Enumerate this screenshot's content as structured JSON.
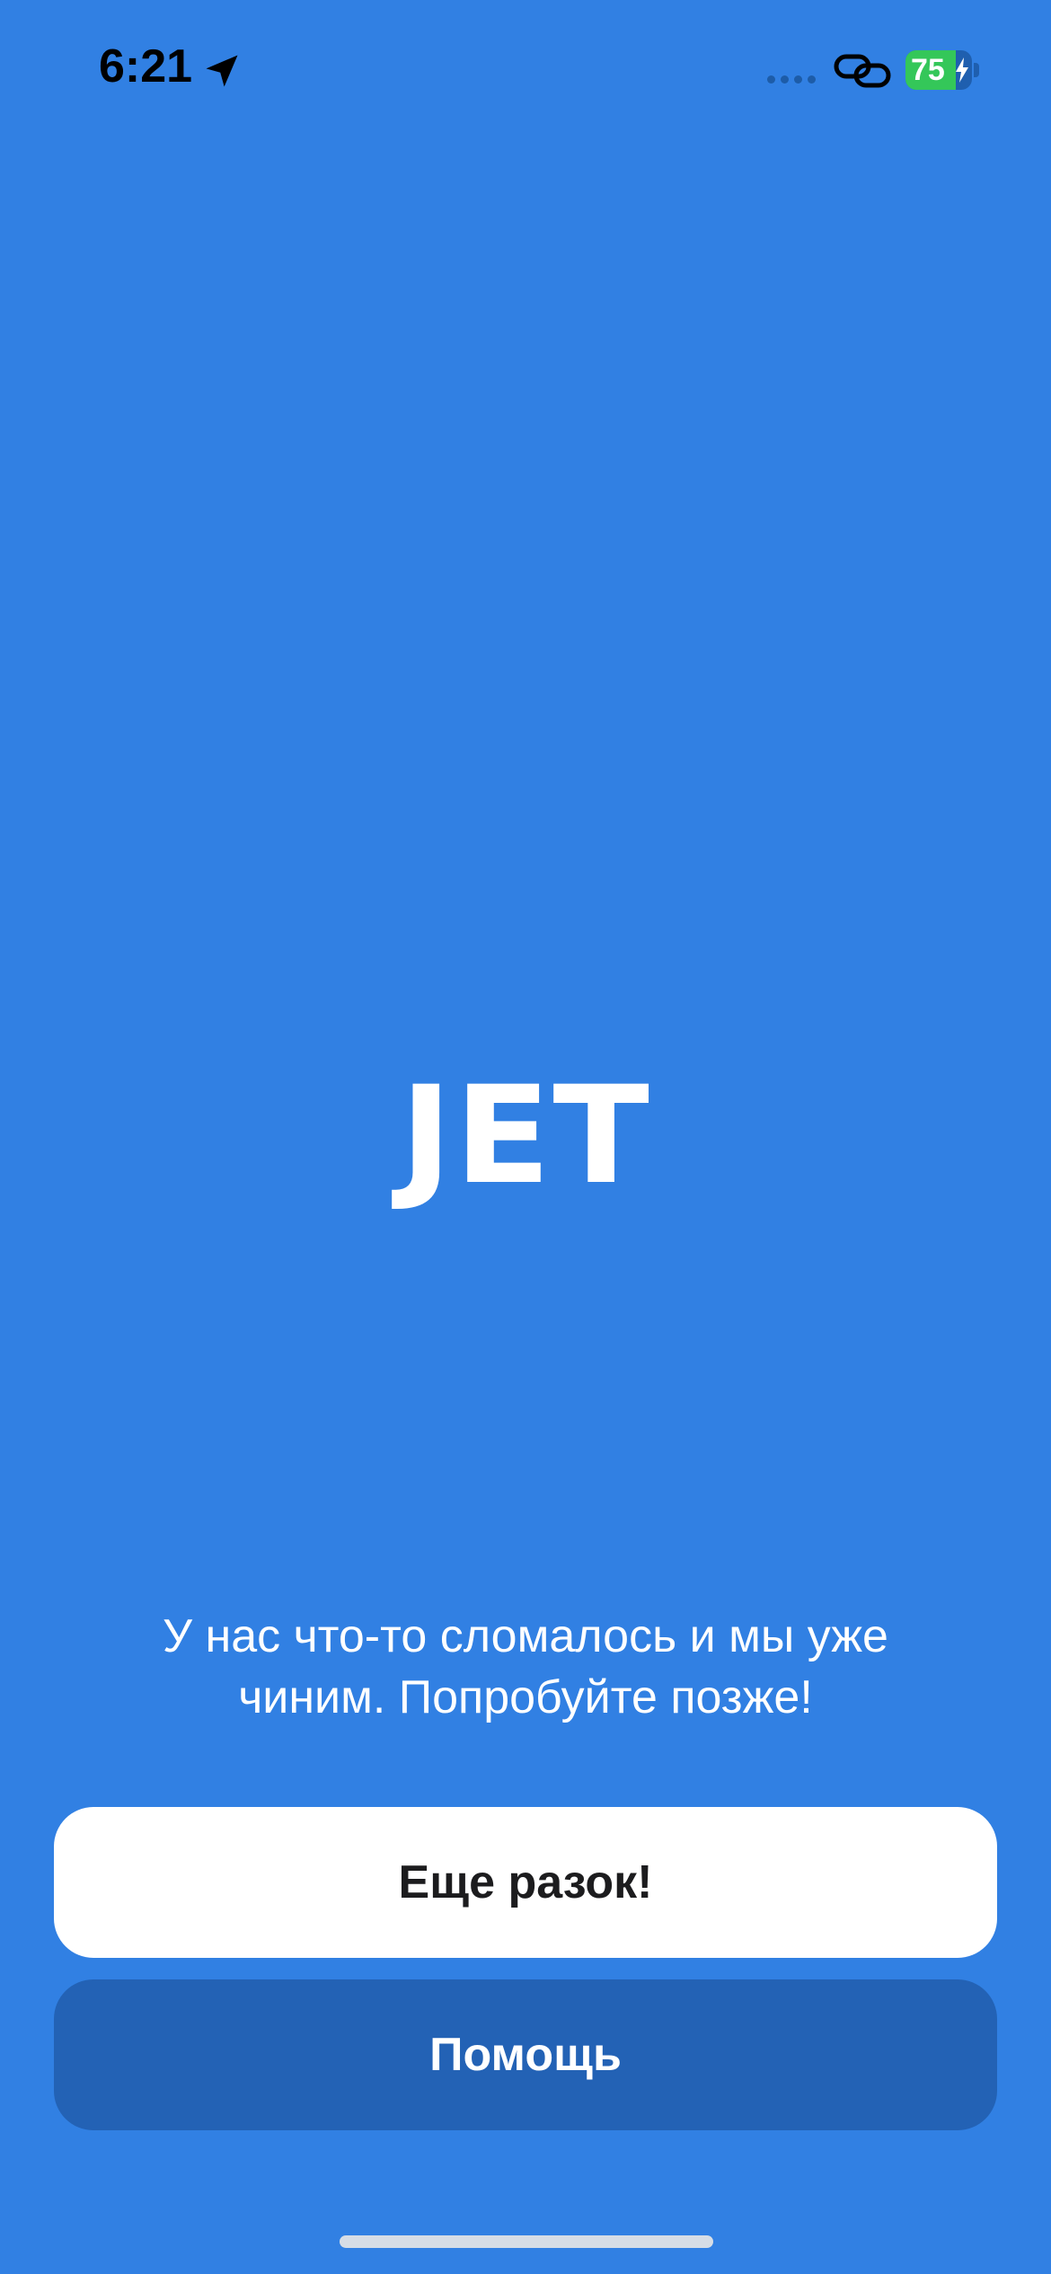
{
  "status_bar": {
    "time": "6:21",
    "battery_level": "75",
    "battery_fraction": 0.75
  },
  "app": {
    "logo": "JET"
  },
  "error": {
    "message_line1": "У нас что-то сломалось и мы уже",
    "message_line2": "чиним. Попробуйте позже!"
  },
  "actions": {
    "retry_label": "Еще разок!",
    "help_label": "Помощь"
  },
  "colors": {
    "background": "#3180E3",
    "primary_button": "#FFFFFF",
    "secondary_button": "#2362B5",
    "battery_green": "#34C759"
  }
}
